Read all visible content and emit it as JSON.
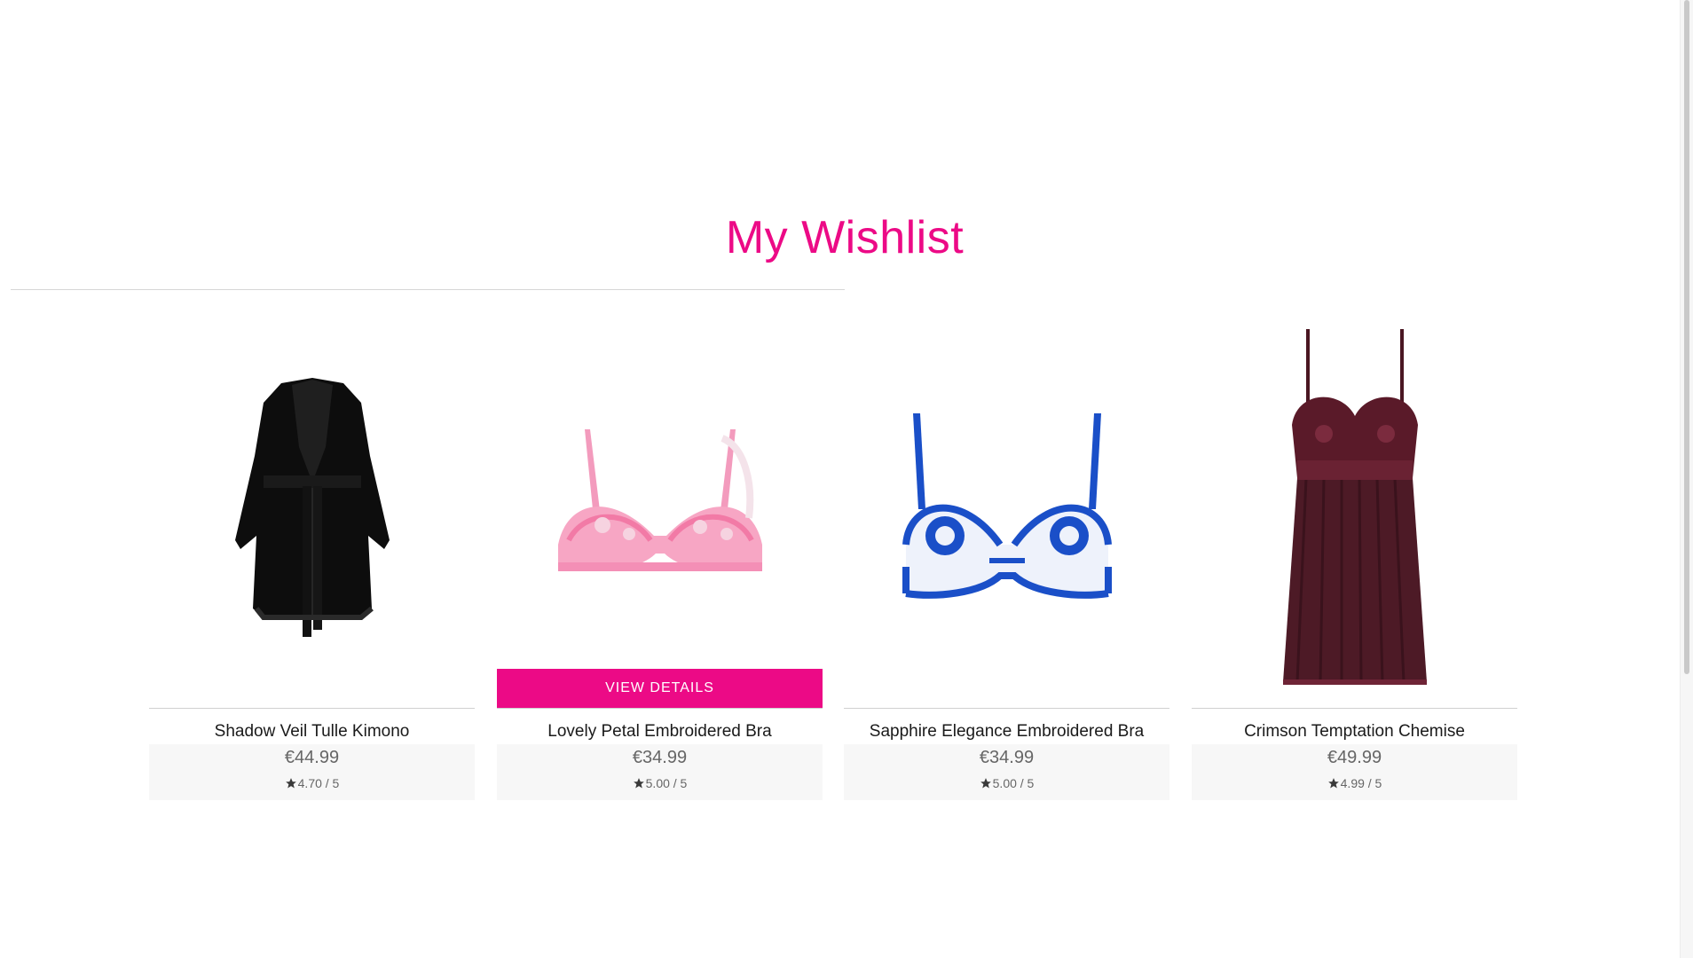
{
  "page": {
    "title": "My Wishlist",
    "accent_color": "#ec0a86"
  },
  "products": [
    {
      "name": "Shadow Veil Tulle Kimono",
      "price": "€44.99",
      "rating": "4.70",
      "rating_max": "/ 5",
      "image": "black-kimono-image",
      "image_colors": [
        "#0c0c0c",
        "#1d1d1d"
      ]
    },
    {
      "name": "Lovely Petal Embroidered Bra",
      "price": "€34.99",
      "rating": "5.00",
      "rating_max": "/ 5",
      "image": "pink-embroidered-bra-image",
      "image_colors": [
        "#f7a6c4",
        "#f4c9d8"
      ],
      "button_label": "VIEW DETAILS"
    },
    {
      "name": "Sapphire Elegance Embroidered Bra",
      "price": "€34.99",
      "rating": "5.00",
      "rating_max": "/ 5",
      "image": "blue-embroidered-bra-image",
      "image_colors": [
        "#1a4fc8",
        "#e9eef9"
      ]
    },
    {
      "name": "Crimson Temptation Chemise",
      "price": "€49.99",
      "rating": "4.99",
      "rating_max": "/ 5",
      "image": "burgundy-chemise-image",
      "image_colors": [
        "#4a1622",
        "#5e1f2c"
      ]
    }
  ]
}
